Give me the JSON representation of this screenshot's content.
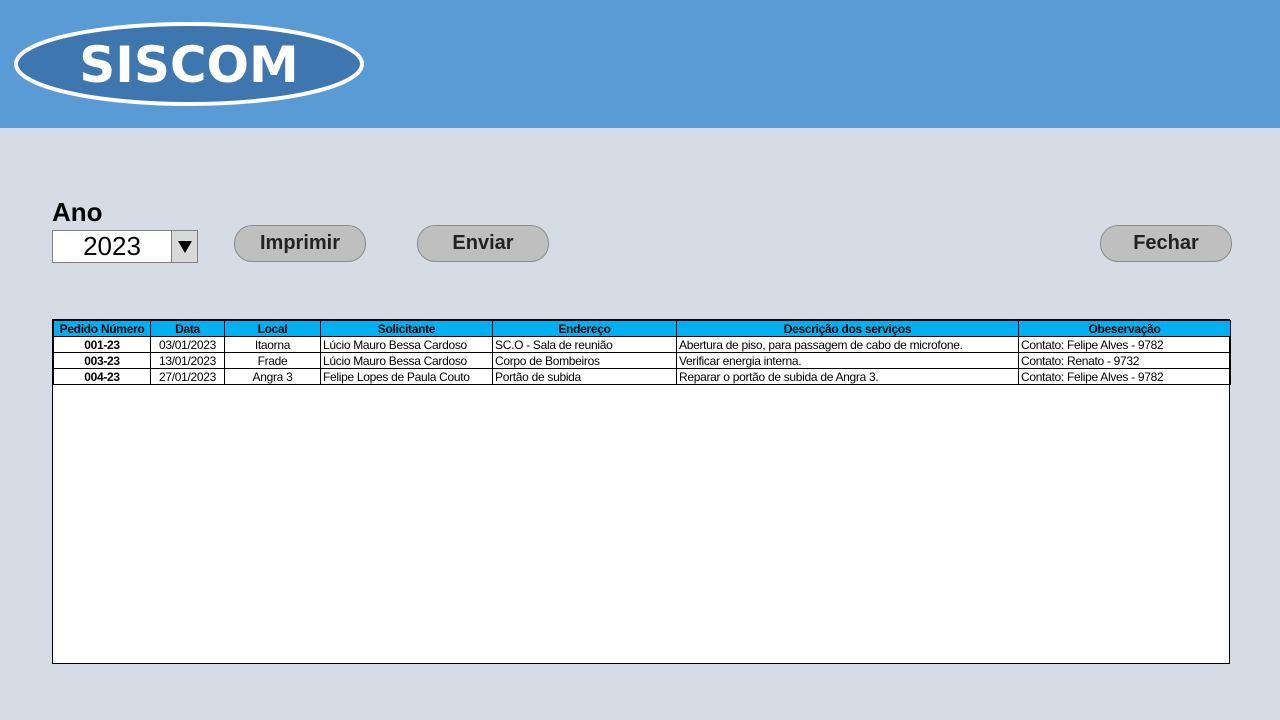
{
  "header": {
    "logo_text": "SISCOM",
    "bg_color": "#5b9bd5",
    "logo_color": "#3e76b0"
  },
  "filter": {
    "label": "Ano",
    "year_value": "2023"
  },
  "buttons": {
    "imprimir": "Imprimir",
    "enviar": "Enviar",
    "fechar": "Fechar"
  },
  "table": {
    "header_color": "#00b0f0",
    "columns": [
      "Pedido Número",
      "Data",
      "Local",
      "Solicitante",
      "Endereço",
      "Descrição dos serviços",
      "Obeservação"
    ],
    "rows": [
      [
        "001-23",
        "03/01/2023",
        "Itaorna",
        "Lúcio Mauro Bessa Cardoso",
        "SC.O - Sala de reunião",
        "Abertura de piso, para passagem de cabo de microfone.",
        "Contato: Felipe Alves - 9782"
      ],
      [
        "003-23",
        "13/01/2023",
        "Frade",
        "Lúcio Mauro Bessa Cardoso",
        "Corpo de Bombeiros",
        "Verificar energia interna.",
        "Contato: Renato - 9732"
      ],
      [
        "004-23",
        "27/01/2023",
        "Angra 3",
        "Felipe Lopes de Paula Couto",
        "Portão de subida",
        "Reparar o portão de subida de Angra 3.",
        "Contato: Felipe Alves - 9782"
      ]
    ]
  }
}
